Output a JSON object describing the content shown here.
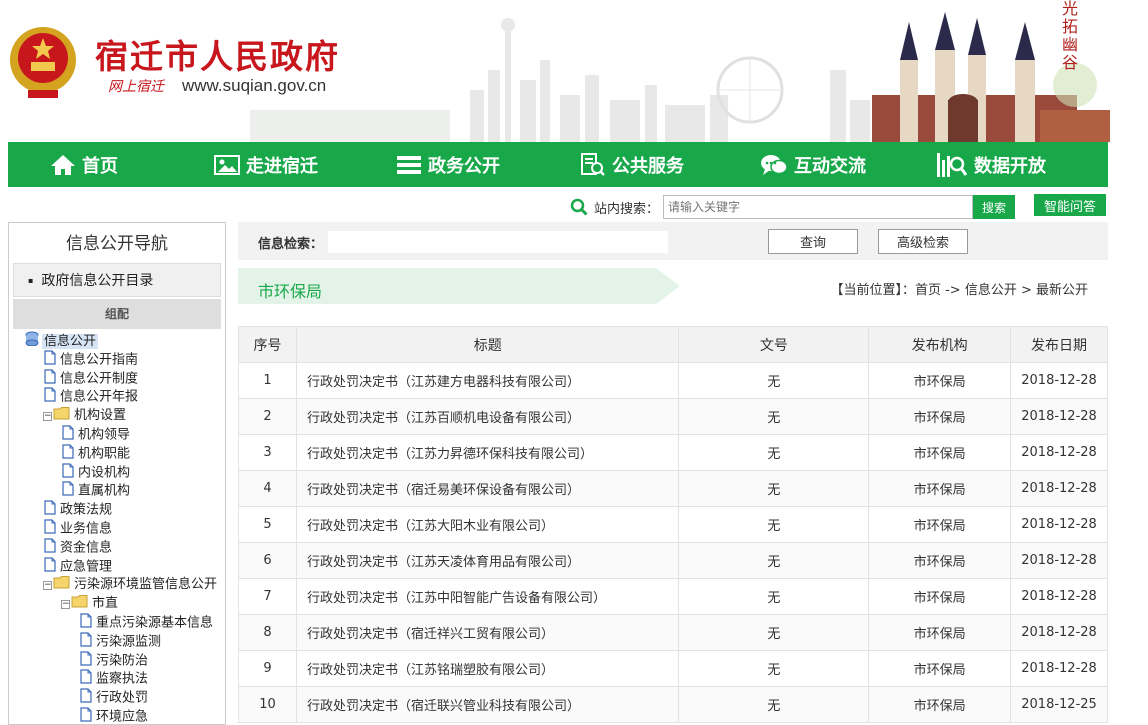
{
  "header": {
    "title": "宿迁市人民政府",
    "subtitle": "网上宿迁",
    "url": "www.suqian.gov.cn",
    "calligraphy": "光拓幽谷"
  },
  "nav": [
    {
      "label": "首页",
      "icon": "home-icon"
    },
    {
      "label": "走进宿迁",
      "icon": "picture-icon"
    },
    {
      "label": "政务公开",
      "icon": "list-icon"
    },
    {
      "label": "公共服务",
      "icon": "search-doc-icon"
    },
    {
      "label": "互动交流",
      "icon": "chat-icon"
    },
    {
      "label": "数据开放",
      "icon": "chart-search-icon"
    }
  ],
  "search": {
    "label": "站内搜索：",
    "placeholder": "请输入关键字",
    "button": "搜索",
    "ai_button": "智能问答"
  },
  "sidebar": {
    "title": "信息公开导航",
    "category": "政府信息公开目录",
    "group": "组配",
    "tree": [
      {
        "label": "信息公开",
        "level": 0,
        "type": "root",
        "selected": true
      },
      {
        "label": "信息公开指南",
        "level": 1,
        "type": "doc"
      },
      {
        "label": "信息公开制度",
        "level": 1,
        "type": "doc"
      },
      {
        "label": "信息公开年报",
        "level": 1,
        "type": "doc"
      },
      {
        "label": "机构设置",
        "level": 1,
        "type": "folder"
      },
      {
        "label": "机构领导",
        "level": 2,
        "type": "doc"
      },
      {
        "label": "机构职能",
        "level": 2,
        "type": "doc"
      },
      {
        "label": "内设机构",
        "level": 2,
        "type": "doc"
      },
      {
        "label": "直属机构",
        "level": 2,
        "type": "doc"
      },
      {
        "label": "政策法规",
        "level": 1,
        "type": "doc"
      },
      {
        "label": "业务信息",
        "level": 1,
        "type": "doc"
      },
      {
        "label": "资金信息",
        "level": 1,
        "type": "doc"
      },
      {
        "label": "应急管理",
        "level": 1,
        "type": "doc"
      },
      {
        "label": "污染源环境监管信息公开",
        "level": 1,
        "type": "folder"
      },
      {
        "label": "市直",
        "level": 2,
        "type": "folder"
      },
      {
        "label": "重点污染源基本信息",
        "level": 3,
        "type": "doc"
      },
      {
        "label": "污染源监测",
        "level": 3,
        "type": "doc"
      },
      {
        "label": "污染防治",
        "level": 3,
        "type": "doc"
      },
      {
        "label": "监察执法",
        "level": 3,
        "type": "doc"
      },
      {
        "label": "行政处罚",
        "level": 3,
        "type": "doc"
      },
      {
        "label": "环境应急",
        "level": 3,
        "type": "doc"
      }
    ]
  },
  "filter": {
    "label": "信息检索：",
    "query_button": "查询",
    "advanced_button": "高级检索"
  },
  "section": {
    "name": "市环保局",
    "breadcrumb": "【当前位置】：首页 -> 信息公开 > 最新公开"
  },
  "table": {
    "headers": [
      "序号",
      "标题",
      "文号",
      "发布机构",
      "发布日期"
    ],
    "rows": [
      [
        "1",
        "行政处罚决定书（江苏建方电器科技有限公司）",
        "无",
        "市环保局",
        "2018-12-28"
      ],
      [
        "2",
        "行政处罚决定书（江苏百顺机电设备有限公司）",
        "无",
        "市环保局",
        "2018-12-28"
      ],
      [
        "3",
        "行政处罚决定书（江苏力昇德环保科技有限公司）",
        "无",
        "市环保局",
        "2018-12-28"
      ],
      [
        "4",
        "行政处罚决定书（宿迁易美环保设备有限公司）",
        "无",
        "市环保局",
        "2018-12-28"
      ],
      [
        "5",
        "行政处罚决定书（江苏大阳木业有限公司）",
        "无",
        "市环保局",
        "2018-12-28"
      ],
      [
        "6",
        "行政处罚决定书（江苏天凌体育用品有限公司）",
        "无",
        "市环保局",
        "2018-12-28"
      ],
      [
        "7",
        "行政处罚决定书（江苏中阳智能广告设备有限公司）",
        "无",
        "市环保局",
        "2018-12-28"
      ],
      [
        "8",
        "行政处罚决定书（宿迁祥兴工贸有限公司）",
        "无",
        "市环保局",
        "2018-12-28"
      ],
      [
        "9",
        "行政处罚决定书（江苏铭瑞塑胶有限公司）",
        "无",
        "市环保局",
        "2018-12-28"
      ],
      [
        "10",
        "行政处罚决定书（宿迁联兴管业科技有限公司）",
        "无",
        "市环保局",
        "2018-12-25"
      ]
    ]
  },
  "colors": {
    "primary": "#18a84a",
    "title_red": "#c8161d"
  }
}
